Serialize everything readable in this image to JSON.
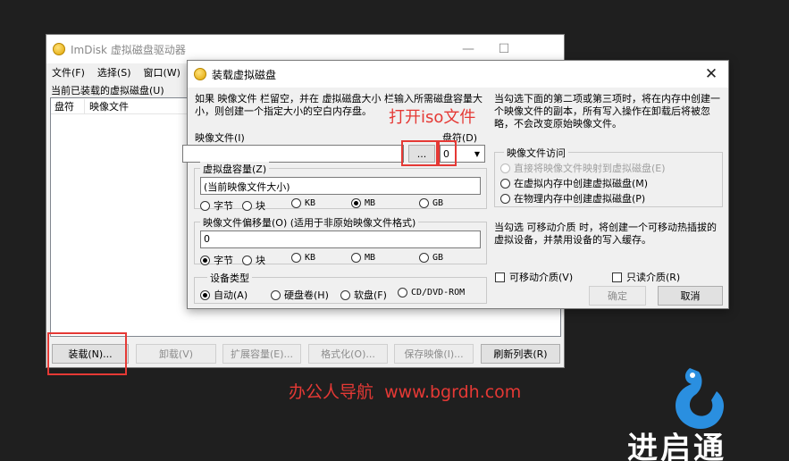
{
  "main_window": {
    "title": "ImDisk 虚拟磁盘驱动器",
    "menu": [
      "文件(F)",
      "选择(S)",
      "窗口(W)"
    ],
    "list_caption": "当前已装载的虚拟磁盘(U)",
    "columns": [
      "盘符",
      "映像文件"
    ],
    "buttons": {
      "mount": "装载(N)...",
      "unmount": "卸载(V)",
      "extend": "扩展容量(E)...",
      "format": "格式化(O)...",
      "save": "保存映像(I)...",
      "refresh": "刷新列表(R)"
    }
  },
  "dialog": {
    "title": "装载虚拟磁盘",
    "hint_left": "如果 映像文件 栏留空，并在 虚拟磁盘大小 栏输入所需磁盘容量大小，则创建一个指定大小的空白内存盘。",
    "hint_right": "当勾选下面的第二项或第三项时，将在内存中创建一个映像文件的副本，所有写入操作在卸载后将被忽略，不会改变原始映像文件。",
    "image_file_label": "映像文件(I)",
    "image_file_value": "",
    "browse_label": "...",
    "drive_label": "盘符(D)",
    "drive_value": "0",
    "size_group": {
      "label": "虚拟盘容量(Z)",
      "value": "(当前映像文件大小)",
      "units": [
        "字节",
        "块",
        "KB",
        "MB",
        "GB"
      ],
      "selected": "MB"
    },
    "offset_group": {
      "label": "映像文件偏移量(O) (适用于非原始映像文件格式)",
      "value": "0",
      "units": [
        "字节",
        "块",
        "KB",
        "MB",
        "GB"
      ],
      "selected": "字节"
    },
    "device_group": {
      "label": "设备类型",
      "options": [
        "自动(A)",
        "硬盘卷(H)",
        "软盘(F)",
        "CD/DVD-ROM"
      ],
      "selected": "自动(A)"
    },
    "access_group": {
      "label": "映像文件访问",
      "options": [
        "直接将映像文件映射到虚拟磁盘(E)",
        "在虚拟内存中创建虚拟磁盘(M)",
        "在物理内存中创建虚拟磁盘(P)"
      ],
      "disabled_index": 0
    },
    "removable_hint": "当勾选 可移动介质 时，将创建一个可移动热插拔的虚拟设备，并禁用设备的写入缓存。",
    "removable_label": "可移动介质(V)",
    "readonly_label": "只读介质(R)",
    "ok_label": "确定",
    "cancel_label": "取消"
  },
  "annotation": "打开iso文件",
  "watermark": "办公人导航  www.bgrdh.com",
  "logo_text": "进启通",
  "colors": {
    "annotation_red": "#e53935",
    "desktop": "#1f1f1f",
    "logo_blue": "#2a8fe0"
  }
}
